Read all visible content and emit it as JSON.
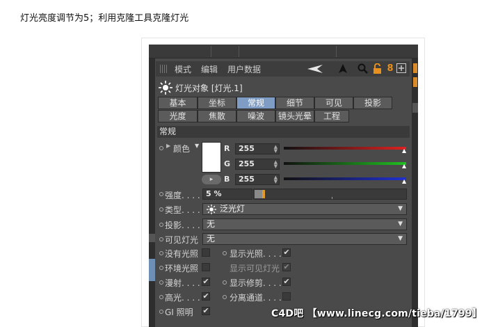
{
  "caption": "灯光亮度调节为5；利用克隆工具克隆灯光",
  "menubar": {
    "items": [
      "模式",
      "编辑",
      "用户数据"
    ],
    "tools": [
      {
        "icon": "back-arrow-icon",
        "glyph": "◀"
      },
      {
        "icon": "cursor-arrow-icon",
        "glyph": "▲"
      },
      {
        "icon": "search-icon",
        "glyph": "🔍"
      },
      {
        "icon": "lock-icon",
        "glyph": "🔓"
      },
      {
        "icon": "link-icon",
        "glyph": "8"
      },
      {
        "icon": "new-panel-icon",
        "glyph": "⊞"
      }
    ]
  },
  "object": {
    "title": "灯光对象 [灯光.1]"
  },
  "tabs_row1": [
    "基本",
    "坐标",
    "常规",
    "细节",
    "可见",
    "投影"
  ],
  "tabs_row2": [
    "光度",
    "焦散",
    "噪波",
    "镜头光晕",
    "工程"
  ],
  "active_tab": "常规",
  "section": {
    "title": "常规"
  },
  "color": {
    "label": "颜色",
    "swatch": "#ffffff",
    "channels": [
      {
        "name": "R",
        "value": "255",
        "color": "#e02020"
      },
      {
        "name": "G",
        "value": "255",
        "color": "#20c020"
      },
      {
        "name": "B",
        "value": "255",
        "color": "#2030d0"
      }
    ]
  },
  "intensity": {
    "label": "强度. . . .",
    "value": "5 %",
    "fraction": 0.05
  },
  "type": {
    "label": "类型. . . .",
    "value": "泛光灯"
  },
  "shadow": {
    "label": "投影. . . .",
    "value": "无"
  },
  "visible_light": {
    "label": "可见灯光",
    "value": "无"
  },
  "checks_left": [
    {
      "label": "没有光照",
      "checked": false
    },
    {
      "label": "环境光照",
      "checked": false
    },
    {
      "label": "漫射. . . .",
      "checked": true
    },
    {
      "label": "高光. . . .",
      "checked": true
    },
    {
      "label": "GI 照明",
      "checked": true
    }
  ],
  "checks_right": [
    {
      "label": "显示光照. . . .",
      "checked": true,
      "dim": false
    },
    {
      "label": "显示可见灯光",
      "checked": true,
      "dim": true
    },
    {
      "label": "显示修剪. . . .",
      "checked": true,
      "dim": false
    },
    {
      "label": "分离通道. . . .",
      "checked": false,
      "dim": false
    }
  ],
  "watermark": "C4D吧 【www.linecg.com/tieba/1799】",
  "colors": {
    "accent_tab": "#7f9cc4",
    "panel_bg": "#4a4a4a",
    "intensity_knob": "#e09a2a"
  }
}
